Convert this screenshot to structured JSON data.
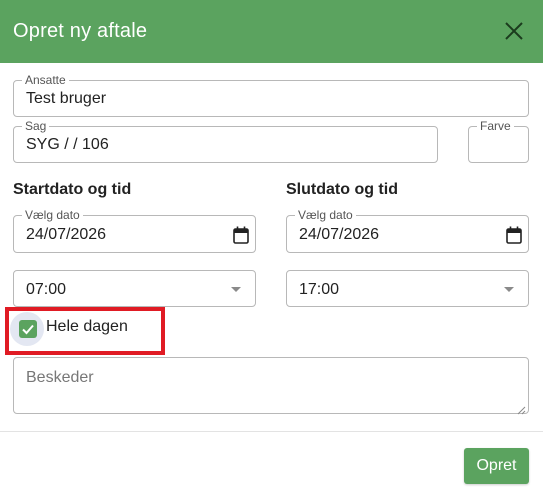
{
  "dialog": {
    "title": "Opret ny aftale",
    "close_icon": "close-icon"
  },
  "employee": {
    "legend": "Ansatte",
    "value": "Test bruger"
  },
  "case": {
    "legend": "Sag",
    "value": "SYG /  / 106"
  },
  "color": {
    "legend": "Farve"
  },
  "start": {
    "heading": "Startdato og tid",
    "date_legend": "Vælg dato",
    "date_value": "24/07/2026",
    "time_value": "07:00"
  },
  "end": {
    "heading": "Slutdato og tid",
    "date_legend": "Vælg dato",
    "date_value": "24/07/2026",
    "time_value": "17:00"
  },
  "all_day": {
    "label": "Hele dagen",
    "checked": true
  },
  "messages": {
    "placeholder": "Beskeder"
  },
  "footer": {
    "submit_label": "Opret"
  },
  "colors": {
    "accent": "#5ba35f",
    "highlight": "#e01b24"
  }
}
